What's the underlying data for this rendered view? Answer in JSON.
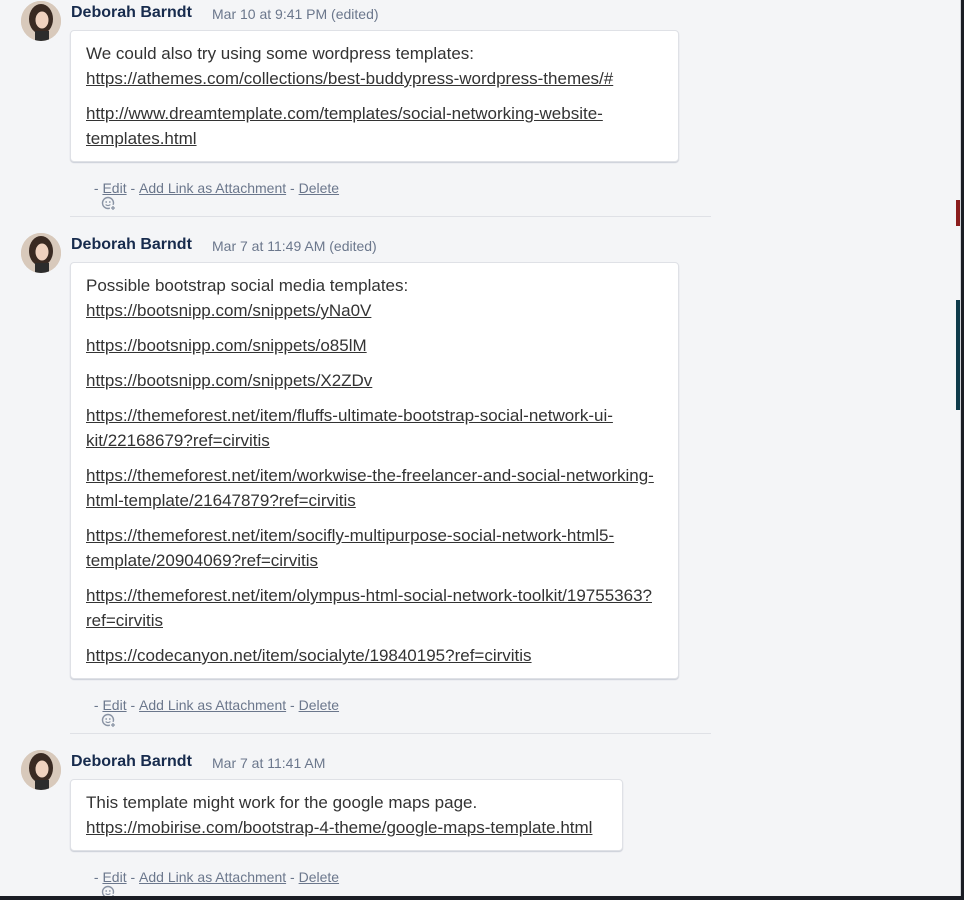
{
  "comments": [
    {
      "author": "Deborah Barndt",
      "timestamp": "Mar 10 at 9:41 PM (edited)",
      "intro": "We could also try using some wordpress templates:",
      "links": [
        "https://athemes.com/collections/best-buddypress-wordpress-themes/#",
        "http://www.dreamtemplate.com/templates/social-networking-website-templates.html"
      ]
    },
    {
      "author": "Deborah Barndt",
      "timestamp": "Mar 7 at 11:49 AM (edited)",
      "intro": "Possible bootstrap social media templates:",
      "links": [
        "https://bootsnipp.com/snippets/yNa0V",
        "https://bootsnipp.com/snippets/o85lM",
        "https://bootsnipp.com/snippets/X2ZDv",
        "https://themeforest.net/item/fluffs-ultimate-bootstrap-social-network-ui-kit/22168679?ref=cirvitis",
        "https://themeforest.net/item/workwise-the-freelancer-and-social-networking-html-template/21647879?ref=cirvitis",
        "https://themeforest.net/item/socifly-multipurpose-social-network-html5-template/20904069?ref=cirvitis",
        "https://themeforest.net/item/olympus-html-social-network-toolkit/19755363?ref=cirvitis",
        "https://codecanyon.net/item/socialyte/19840195?ref=cirvitis"
      ]
    },
    {
      "author": "Deborah Barndt",
      "timestamp": "Mar 7 at 11:41 AM",
      "intro": "This template might work for the google maps page.",
      "links": [
        "https://mobirise.com/bootstrap-4-theme/google-maps-template.html"
      ]
    }
  ],
  "actions": {
    "separator": " - ",
    "edit": "Edit",
    "add_link": "Add Link as Attachment",
    "delete": "Delete",
    "reaction_icon": "add-reaction-icon"
  }
}
